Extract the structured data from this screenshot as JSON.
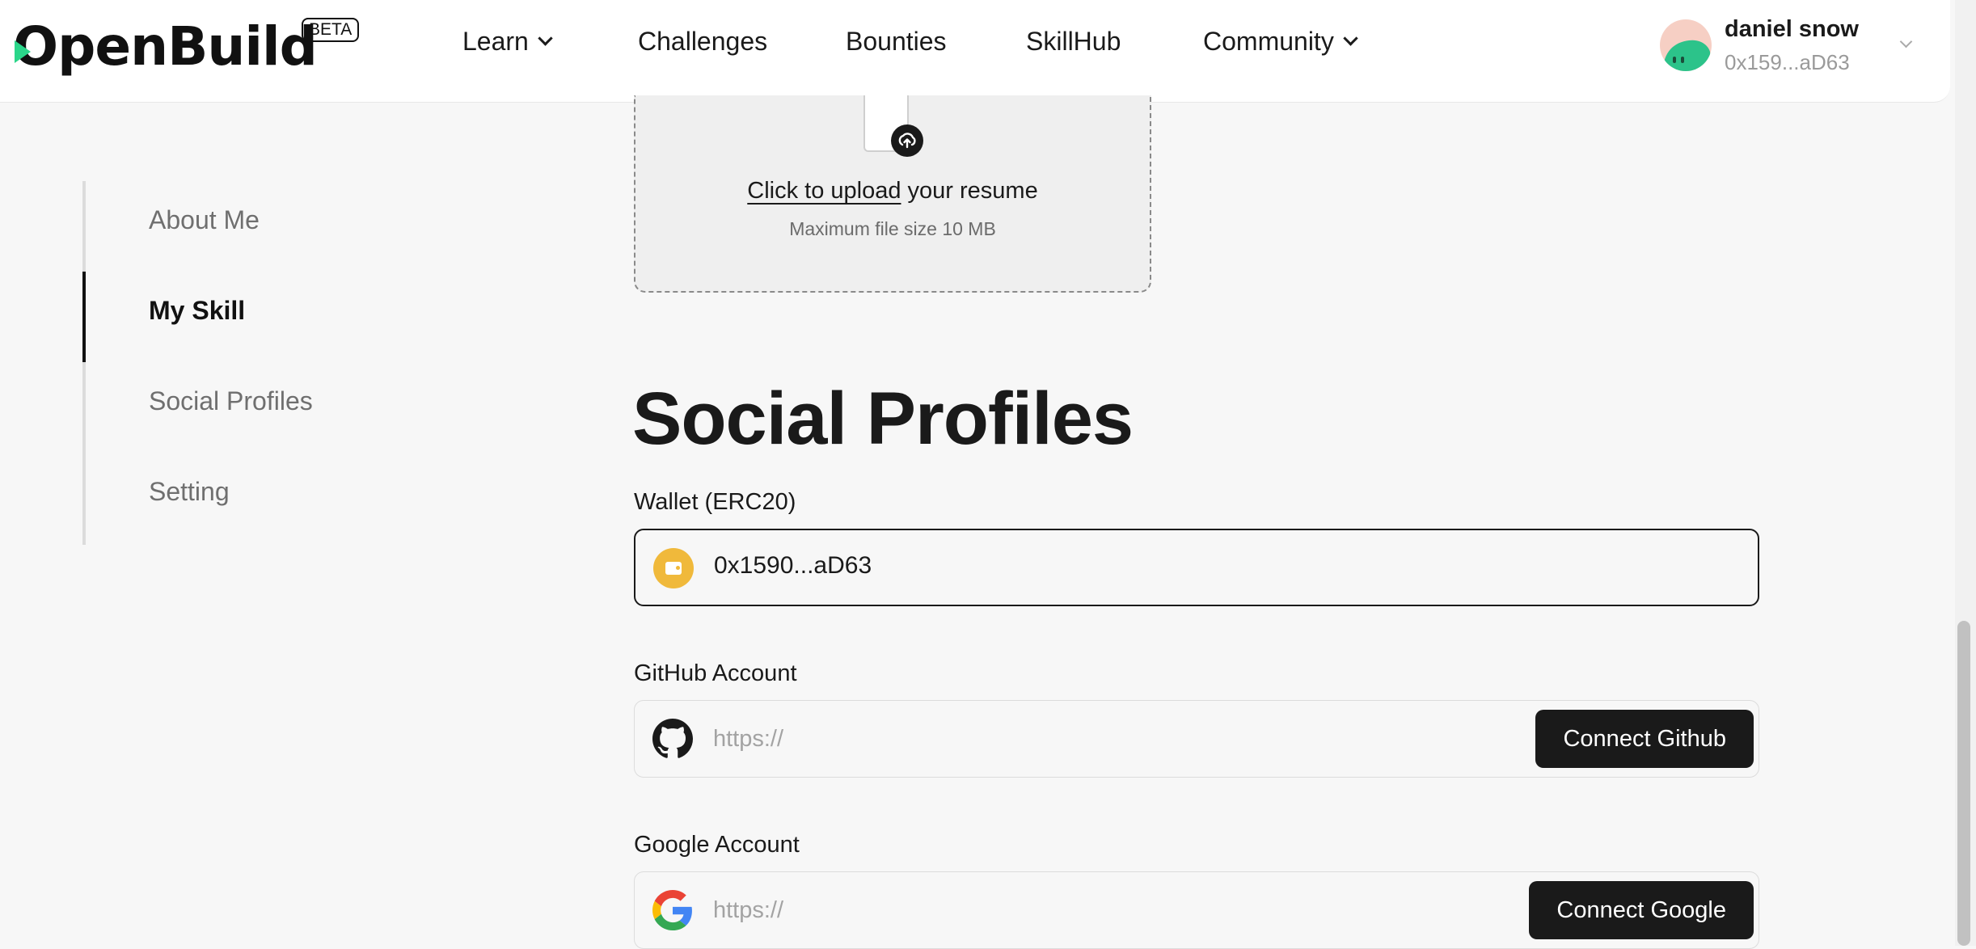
{
  "header": {
    "logo": "OpenBuild",
    "beta_label": "BETA",
    "nav": {
      "learn": "Learn",
      "challenges": "Challenges",
      "bounties": "Bounties",
      "skillhub": "SkillHub",
      "community": "Community"
    },
    "user": {
      "name": "daniel snow",
      "address": "0x159...aD63"
    }
  },
  "sidebar": {
    "items": [
      {
        "label": "About Me"
      },
      {
        "label": "My Skill"
      },
      {
        "label": "Social Profiles"
      },
      {
        "label": "Setting"
      }
    ],
    "active_index": 1
  },
  "upload": {
    "link_text": "Click to upload",
    "rest_text": " your resume",
    "hint": "Maximum file size 10 MB"
  },
  "social": {
    "title": "Social Profiles",
    "wallet": {
      "label": "Wallet (ERC20)",
      "value": "0x1590...aD63",
      "icon": "wallet-icon"
    },
    "github": {
      "label": "GitHub Account",
      "placeholder": "https://",
      "button": "Connect Github",
      "icon": "github-icon"
    },
    "google": {
      "label": "Google Account",
      "placeholder": "https://",
      "button": "Connect Google",
      "icon": "google-icon"
    }
  },
  "colors": {
    "accent": "#2bd68a",
    "wallet": "#f0b93b",
    "button": "#1a1a1a",
    "background": "#f7f7f7"
  }
}
